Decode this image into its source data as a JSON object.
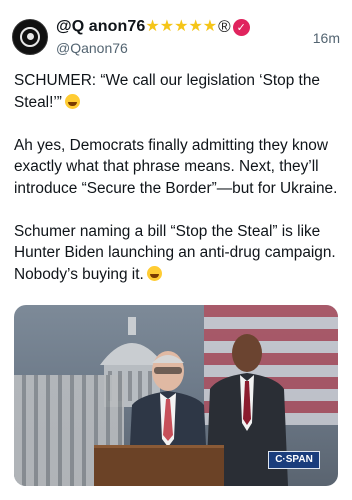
{
  "post": {
    "author": {
      "name": "@Q anon76",
      "verified_badge": "✓",
      "handle": "@Qanon76",
      "star_icons": [
        "star-icon",
        "star-icon",
        "star-icon",
        "star-icon",
        "star-icon"
      ],
      "registered_symbol": "®"
    },
    "time": "16m",
    "text": {
      "p1": "SCHUMER: “We call our legislation ‘Stop the Steal!’”",
      "p2": "Ah yes, Democrats finally admitting they know exactly what that phrase means. Next, they’ll introduce “Secure the Border”—but for Ukraine.",
      "p3": "Schumer naming a bill “Stop the Steal” is like Hunter Biden launching an anti-drug campaign. Nobody’s buying it."
    },
    "media": {
      "watermark": "C·SPAN"
    }
  },
  "colors": {
    "accent_star": "#f5c518",
    "badge": "#e0245e",
    "muted": "#536471"
  }
}
